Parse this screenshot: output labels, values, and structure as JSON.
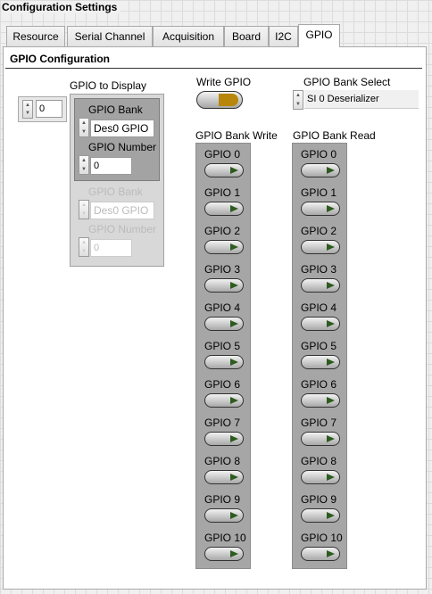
{
  "window": {
    "title": "Configuration Settings"
  },
  "tabs": [
    {
      "label": "Resource"
    },
    {
      "label": "Serial Channel"
    },
    {
      "label": "Acquisition"
    },
    {
      "label": "Board"
    },
    {
      "label": "I2C"
    },
    {
      "label": "GPIO"
    }
  ],
  "active_tab": "GPIO",
  "panel": {
    "title": "GPIO Configuration"
  },
  "gpio_to_display": {
    "label": "GPIO to Display",
    "index": "0",
    "elements": [
      {
        "bank_label": "GPIO Bank",
        "bank_value": "Des0 GPIO",
        "number_label": "GPIO Number",
        "number_value": "0",
        "enabled": true
      },
      {
        "bank_label": "GPIO Bank",
        "bank_value": "Des0 GPIO",
        "number_label": "GPIO Number",
        "number_value": "0",
        "enabled": false
      }
    ]
  },
  "write_gpio": {
    "label": "Write GPIO",
    "led_color": "#b8860b"
  },
  "bank_select": {
    "label": "GPIO Bank Select",
    "value": "SI 0 Deserializer"
  },
  "bank_write": {
    "label": "GPIO Bank Write",
    "items": [
      "GPIO 0",
      "GPIO 1",
      "GPIO 2",
      "GPIO 3",
      "GPIO 4",
      "GPIO 5",
      "GPIO 6",
      "GPIO 7",
      "GPIO 8",
      "GPIO 9",
      "GPIO 10"
    ]
  },
  "bank_read": {
    "label": "GPIO Bank Read",
    "items": [
      "GPIO 0",
      "GPIO 1",
      "GPIO 2",
      "GPIO 3",
      "GPIO 4",
      "GPIO 5",
      "GPIO 6",
      "GPIO 7",
      "GPIO 8",
      "GPIO 9",
      "GPIO 10"
    ]
  },
  "colors": {
    "led_off": "#2d5a1f",
    "panel_bg": "#ffffff",
    "column_bg": "#a6a6a6"
  }
}
